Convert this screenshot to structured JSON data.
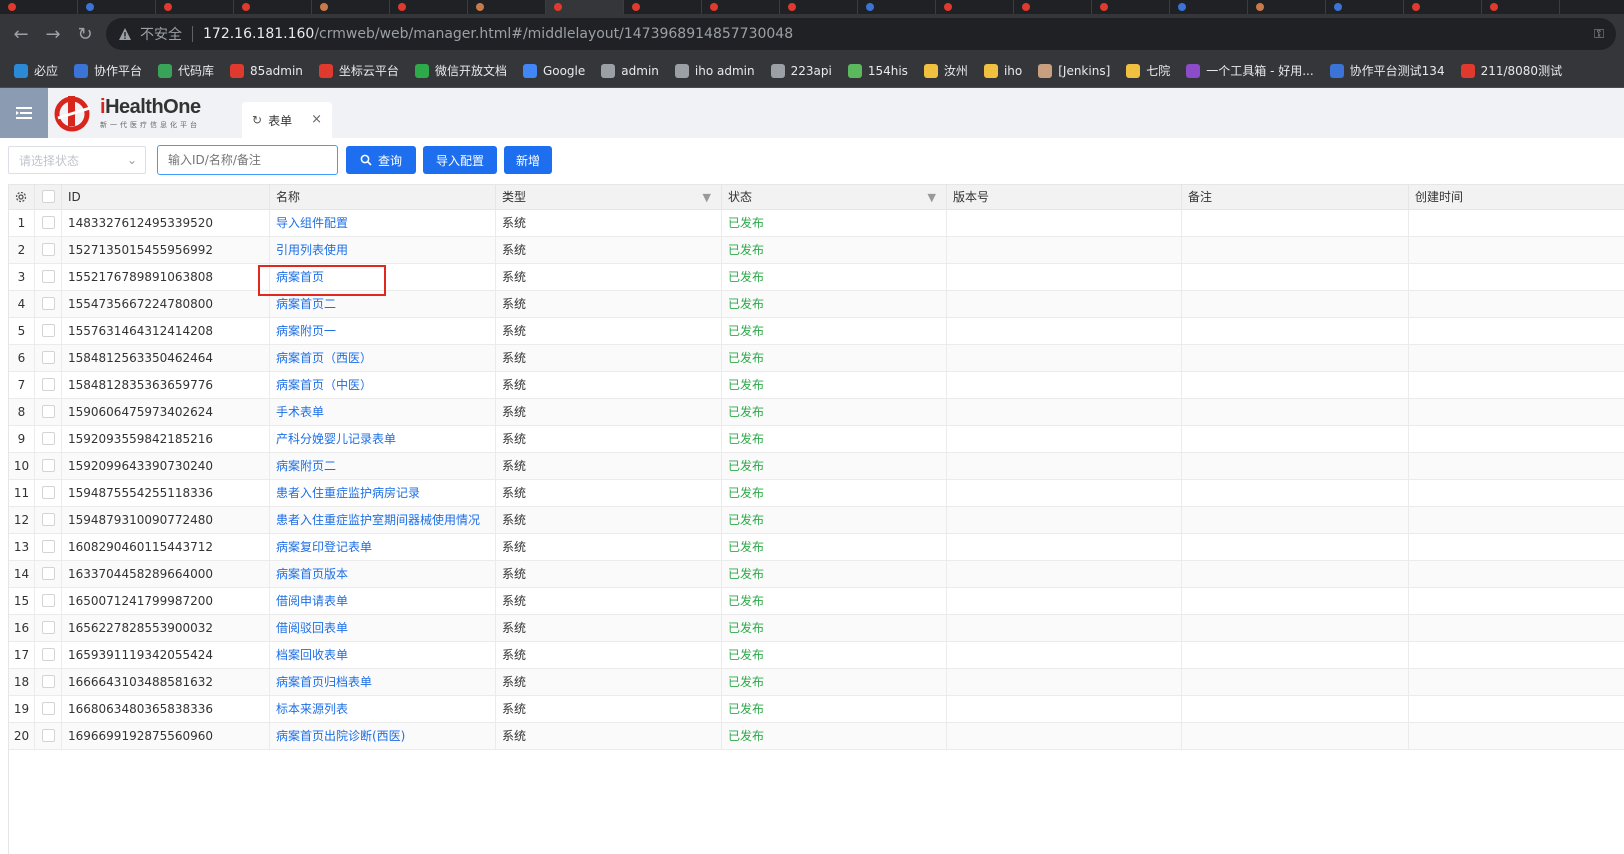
{
  "browser": {
    "tab_colors": [
      "#e03a2f",
      "#3b74d6",
      "#e03a2f",
      "#e03a2f",
      "#c97a4a",
      "#e03a2f",
      "#c97a4a",
      "#e03a2f",
      "#e03a2f",
      "#e03a2f",
      "#e03a2f",
      "#3b74d6",
      "#e03a2f",
      "#e03a2f",
      "#e03a2f",
      "#3b74d6",
      "#c97a4a",
      "#3b74d6",
      "#e03a2f",
      "#e03a2f"
    ],
    "insecure_label": "不安全",
    "url_host": "172.16.181.160",
    "url_path": "/crmweb/web/manager.html#/middlelayout/1473968914857730048",
    "bookmarks": [
      {
        "label": "必应",
        "color": "#2a8ad6"
      },
      {
        "label": "协作平台",
        "color": "#3b74d6"
      },
      {
        "label": "代码库",
        "color": "#3aa35a"
      },
      {
        "label": "85admin",
        "color": "#e03a2f"
      },
      {
        "label": "坐标云平台",
        "color": "#e03a2f"
      },
      {
        "label": "微信开放文档",
        "color": "#2eaa4a"
      },
      {
        "label": "Google",
        "color": "#4285f4"
      },
      {
        "label": "admin",
        "color": "#9aa0a6"
      },
      {
        "label": "iho admin",
        "color": "#9aa0a6"
      },
      {
        "label": "223api",
        "color": "#9aa0a6"
      },
      {
        "label": "154his",
        "color": "#5cb85c"
      },
      {
        "label": "汝州",
        "color": "#f0c040"
      },
      {
        "label": "iho",
        "color": "#f0c040"
      },
      {
        "label": "[Jenkins]",
        "color": "#c8a080"
      },
      {
        "label": "七院",
        "color": "#f0c040"
      },
      {
        "label": "一个工具箱 - 好用...",
        "color": "#8c4cc9"
      },
      {
        "label": "协作平台测试134",
        "color": "#3b74d6"
      },
      {
        "label": "211/8080测试",
        "color": "#e03a2f"
      }
    ]
  },
  "app": {
    "logo_main": "HealthOne",
    "logo_prefix": "i",
    "logo_sub": "新一代医疗信息化平台",
    "page_tab": "表单",
    "toolbar": {
      "status_placeholder": "请选择状态",
      "search_placeholder": "输入ID/名称/备注",
      "query_label": "查询",
      "import_label": "导入配置",
      "add_label": "新增"
    },
    "columns": {
      "id": "ID",
      "name": "名称",
      "type": "类型",
      "status": "状态",
      "version": "版本号",
      "remark": "备注",
      "created": "创建时间"
    },
    "rows": [
      {
        "no": "1",
        "id": "1483327612495339520",
        "name": "导入组件配置",
        "type": "系统",
        "status": "已发布"
      },
      {
        "no": "2",
        "id": "1527135015455956992",
        "name": "引用列表使用",
        "type": "系统",
        "status": "已发布"
      },
      {
        "no": "3",
        "id": "1552176789891063808",
        "name": "病案首页",
        "type": "系统",
        "status": "已发布"
      },
      {
        "no": "4",
        "id": "1554735667224780800",
        "name": "病案首页二",
        "type": "系统",
        "status": "已发布"
      },
      {
        "no": "5",
        "id": "1557631464312414208",
        "name": "病案附页一",
        "type": "系统",
        "status": "已发布"
      },
      {
        "no": "6",
        "id": "1584812563350462464",
        "name": "病案首页（西医）",
        "type": "系统",
        "status": "已发布"
      },
      {
        "no": "7",
        "id": "1584812835363659776",
        "name": "病案首页（中医）",
        "type": "系统",
        "status": "已发布"
      },
      {
        "no": "8",
        "id": "1590606475973402624",
        "name": "手术表单",
        "type": "系统",
        "status": "已发布"
      },
      {
        "no": "9",
        "id": "1592093559842185216",
        "name": "产科分娩婴儿记录表单",
        "type": "系统",
        "status": "已发布"
      },
      {
        "no": "10",
        "id": "1592099643390730240",
        "name": "病案附页二",
        "type": "系统",
        "status": "已发布"
      },
      {
        "no": "11",
        "id": "1594875554255118336",
        "name": "患者入住重症监护病房记录",
        "type": "系统",
        "status": "已发布"
      },
      {
        "no": "12",
        "id": "1594879310090772480",
        "name": "患者入住重症监护室期间器械使用情况",
        "type": "系统",
        "status": "已发布"
      },
      {
        "no": "13",
        "id": "1608290460115443712",
        "name": "病案复印登记表单",
        "type": "系统",
        "status": "已发布"
      },
      {
        "no": "14",
        "id": "1633704458289664000",
        "name": "病案首页版本",
        "type": "系统",
        "status": "已发布"
      },
      {
        "no": "15",
        "id": "1650071241799987200",
        "name": "借阅申请表单",
        "type": "系统",
        "status": "已发布"
      },
      {
        "no": "16",
        "id": "1656227828553900032",
        "name": "借阅驳回表单",
        "type": "系统",
        "status": "已发布"
      },
      {
        "no": "17",
        "id": "1659391119342055424",
        "name": "档案回收表单",
        "type": "系统",
        "status": "已发布"
      },
      {
        "no": "18",
        "id": "1666643103488581632",
        "name": "病案首页归档表单",
        "type": "系统",
        "status": "已发布"
      },
      {
        "no": "19",
        "id": "1668063480365838336",
        "name": "标本来源列表",
        "type": "系统",
        "status": "已发布"
      },
      {
        "no": "20",
        "id": "1696699192875560960",
        "name": "病案首页出院诊断(西医)",
        "type": "系统",
        "status": "已发布"
      }
    ]
  }
}
